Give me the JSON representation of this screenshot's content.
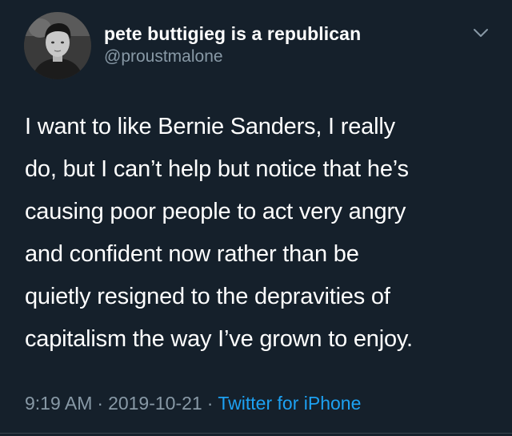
{
  "colors": {
    "background": "#15202b",
    "text": "#ffffff",
    "secondary_text": "#8899a6",
    "link": "#1da1f2"
  },
  "user": {
    "display_name": "pete buttigieg is a republican",
    "handle": "@proustmalone",
    "avatar_icon": "profile-photo"
  },
  "menu_icon": "chevron-down-icon",
  "tweet": {
    "lines": [
      "I want to like Bernie Sanders, I really",
      "do, but I can’t help but notice that he’s",
      "causing poor people to act very angry",
      "and confident now rather than be",
      "quietly resigned to the depravities of",
      "capitalism the way I’ve grown to enjoy."
    ],
    "time": "9:19 AM",
    "separator": "·",
    "date": "2019-10-21",
    "source": "Twitter for iPhone"
  }
}
